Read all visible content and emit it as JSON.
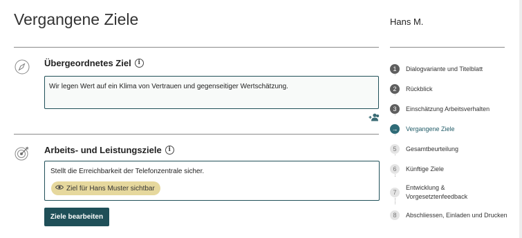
{
  "page": {
    "title": "Vergangene Ziele",
    "user_name": "Hans M."
  },
  "overarching_goal": {
    "title": "Übergeordnetes Ziel",
    "text": "Wir legen Wert auf ein Klima von Vertrauen und gegenseitiger Wertschätzung.",
    "icon": "compass-icon"
  },
  "performance_goals": {
    "title": "Arbeits- und Leistungsziele",
    "icon": "target-icon",
    "goal_text": "Stellt die Erreichbarkeit der Telefonzentrale sicher.",
    "visibility_badge": "Ziel für Hans Muster sichtbar"
  },
  "edit_button": "Ziele bearbeiten",
  "steps": [
    {
      "num": "1",
      "label": "Dialogvariante und Titelblatt",
      "state": "done"
    },
    {
      "num": "2",
      "label": "Rückblick",
      "state": "done"
    },
    {
      "num": "3",
      "label": "Einschätzung Arbeitsverhalten",
      "state": "done"
    },
    {
      "num": "→",
      "label": "Vergangene Ziele",
      "state": "active"
    },
    {
      "num": "5",
      "label": "Gesamtbeurteilung",
      "state": "todo"
    },
    {
      "num": "6",
      "label": "Künftige Ziele",
      "state": "todo"
    },
    {
      "num": "7",
      "label": "Entwicklung & Vorgesetztenfeedback",
      "state": "todo"
    },
    {
      "num": "8",
      "label": "Abschliessen, Einladen und Drucken",
      "state": "todo"
    }
  ],
  "colors": {
    "accent": "#1f4f58",
    "badge": "#e6d89d",
    "step_done": "#5e5e5e",
    "step_active": "#2f6b77",
    "step_todo": "#e4e4e4"
  }
}
